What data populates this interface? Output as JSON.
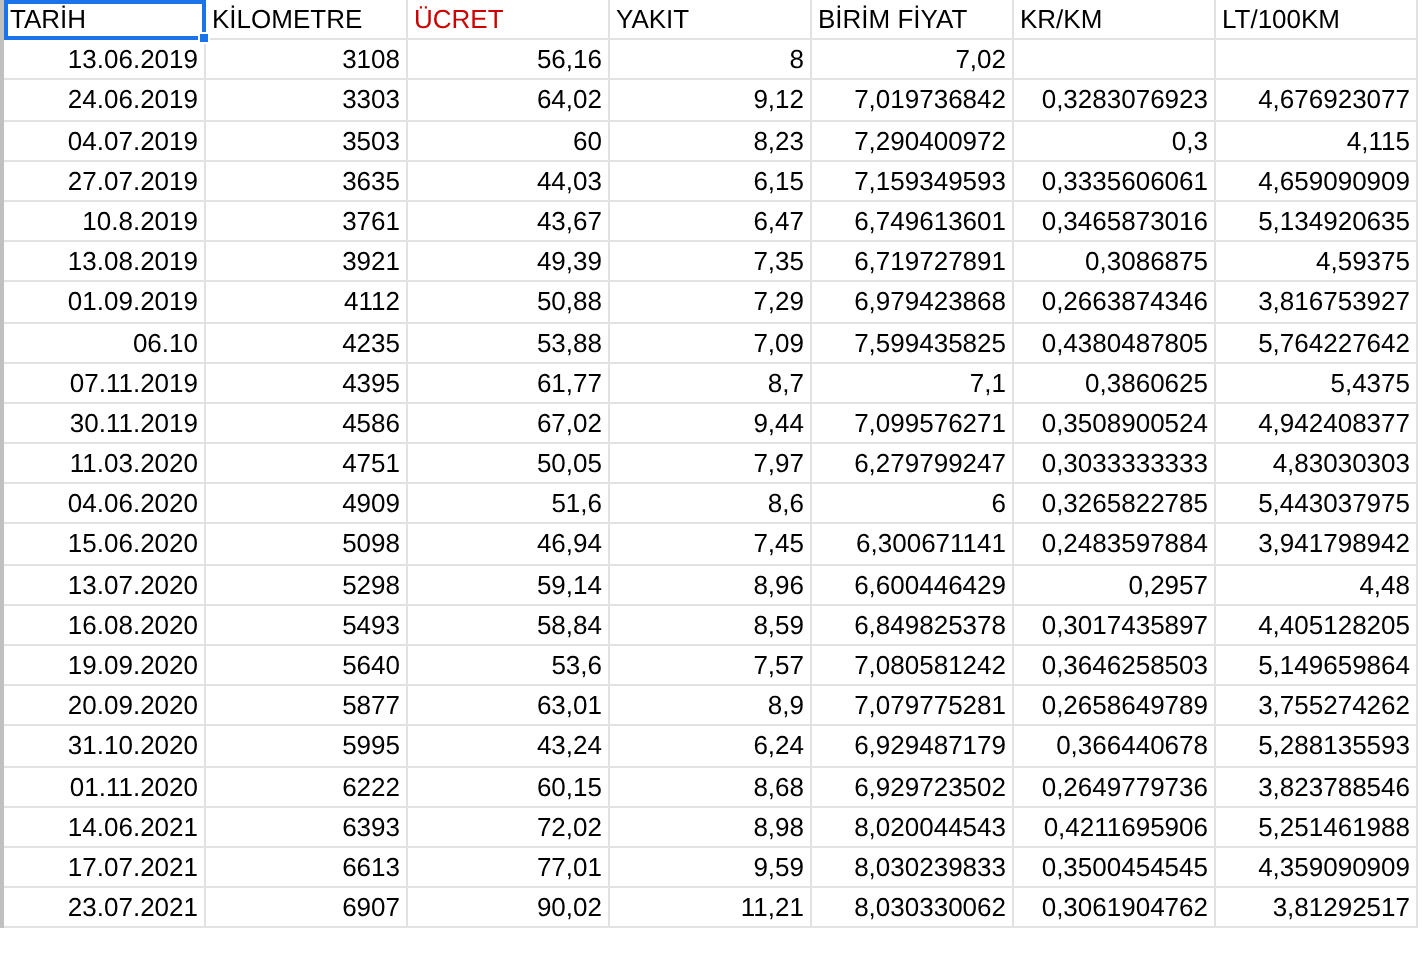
{
  "columns": [
    {
      "label": "TARİH",
      "selected": true,
      "color": "#000000"
    },
    {
      "label": "KİLOMETRE",
      "selected": false,
      "color": "#000000"
    },
    {
      "label": "ÜCRET",
      "selected": false,
      "color": "#cc0000"
    },
    {
      "label": "YAKIT",
      "selected": false,
      "color": "#000000"
    },
    {
      "label": "BİRİM FİYAT",
      "selected": false,
      "color": "#000000"
    },
    {
      "label": "KR/KM",
      "selected": false,
      "color": "#000000"
    },
    {
      "label": "LT/100KM",
      "selected": false,
      "color": "#000000"
    }
  ],
  "rows": [
    [
      "13.06.2019",
      "3108",
      "56,16",
      "8",
      "7,02",
      "",
      ""
    ],
    [
      "24.06.2019",
      "3303",
      "64,02",
      "9,12",
      "7,019736842",
      "0,3283076923",
      "4,676923077"
    ],
    [
      "04.07.2019",
      "3503",
      "60",
      "8,23",
      "7,290400972",
      "0,3",
      "4,115"
    ],
    [
      "27.07.2019",
      "3635",
      "44,03",
      "6,15",
      "7,159349593",
      "0,3335606061",
      "4,659090909"
    ],
    [
      "10.8.2019",
      "3761",
      "43,67",
      "6,47",
      "6,749613601",
      "0,3465873016",
      "5,134920635"
    ],
    [
      "13.08.2019",
      "3921",
      "49,39",
      "7,35",
      "6,719727891",
      "0,3086875",
      "4,59375"
    ],
    [
      "01.09.2019",
      "4112",
      "50,88",
      "7,29",
      "6,979423868",
      "0,2663874346",
      "3,816753927"
    ],
    [
      "06.10",
      "4235",
      "53,88",
      "7,09",
      "7,599435825",
      "0,4380487805",
      "5,764227642"
    ],
    [
      "07.11.2019",
      "4395",
      "61,77",
      "8,7",
      "7,1",
      "0,3860625",
      "5,4375"
    ],
    [
      "30.11.2019",
      "4586",
      "67,02",
      "9,44",
      "7,099576271",
      "0,3508900524",
      "4,942408377"
    ],
    [
      "11.03.2020",
      "4751",
      "50,05",
      "7,97",
      "6,279799247",
      "0,3033333333",
      "4,83030303"
    ],
    [
      "04.06.2020",
      "4909",
      "51,6",
      "8,6",
      "6",
      "0,3265822785",
      "5,443037975"
    ],
    [
      "15.06.2020",
      "5098",
      "46,94",
      "7,45",
      "6,300671141",
      "0,2483597884",
      "3,941798942"
    ],
    [
      "13.07.2020",
      "5298",
      "59,14",
      "8,96",
      "6,600446429",
      "0,2957",
      "4,48"
    ],
    [
      "16.08.2020",
      "5493",
      "58,84",
      "8,59",
      "6,849825378",
      "0,3017435897",
      "4,405128205"
    ],
    [
      "19.09.2020",
      "5640",
      "53,6",
      "7,57",
      "7,080581242",
      "0,3646258503",
      "5,149659864"
    ],
    [
      "20.09.2020",
      "5877",
      "63,01",
      "8,9",
      "7,079775281",
      "0,2658649789",
      "3,755274262"
    ],
    [
      "31.10.2020",
      "5995",
      "43,24",
      "6,24",
      "6,929487179",
      "0,366440678",
      "5,288135593"
    ],
    [
      "01.11.2020",
      "6222",
      "60,15",
      "8,68",
      "6,929723502",
      "0,2649779736",
      "3,823788546"
    ],
    [
      "14.06.2021",
      "6393",
      "72,02",
      "8,98",
      "8,020044543",
      "0,4211695906",
      "5,251461988"
    ],
    [
      "17.07.2021",
      "6613",
      "77,01",
      "9,59",
      "8,030239833",
      "0,3500454545",
      "4,359090909"
    ],
    [
      "23.07.2021",
      "6907",
      "90,02",
      "11,21",
      "8,030330062",
      "0,3061904762",
      "3,81292517"
    ]
  ]
}
